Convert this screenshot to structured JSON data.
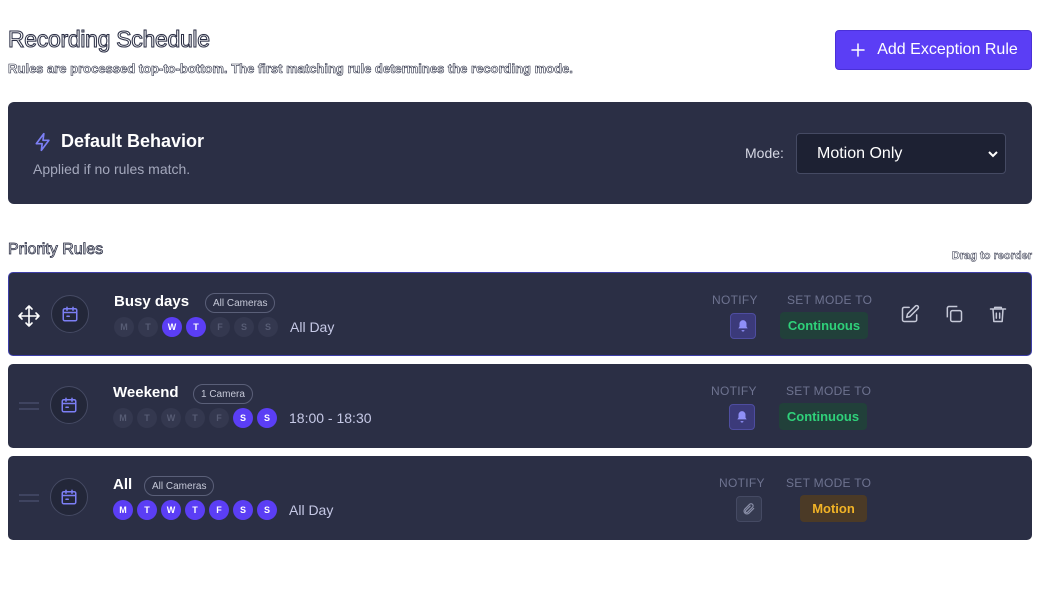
{
  "header": {
    "title": "Recording Schedule",
    "subtitle": "Rules are processed top-to-bottom. The first matching rule determines the recording mode.",
    "add_button_label": "Add Exception Rule"
  },
  "default_behavior": {
    "title": "Default Behavior",
    "subtitle": "Applied if no rules match.",
    "mode_label": "Mode:",
    "mode_value": "Motion Only"
  },
  "priority": {
    "title": "Priority Rules",
    "drag_hint": "Drag to reorder"
  },
  "labels": {
    "notify": "NOTIFY",
    "set_mode_to": "SET MODE TO"
  },
  "rules": [
    {
      "name": "Busy days",
      "scope": "All Cameras",
      "days": [
        {
          "letter": "M",
          "on": false
        },
        {
          "letter": "T",
          "on": false
        },
        {
          "letter": "W",
          "on": true
        },
        {
          "letter": "T",
          "on": true
        },
        {
          "letter": "F",
          "on": false
        },
        {
          "letter": "S",
          "on": false
        },
        {
          "letter": "S",
          "on": false
        }
      ],
      "time": "All Day",
      "notify": "bell-icon",
      "mode": "Continuous"
    },
    {
      "name": "Weekend",
      "scope": "1 Camera",
      "days": [
        {
          "letter": "M",
          "on": false
        },
        {
          "letter": "T",
          "on": false
        },
        {
          "letter": "W",
          "on": false
        },
        {
          "letter": "T",
          "on": false
        },
        {
          "letter": "F",
          "on": false
        },
        {
          "letter": "S",
          "on": true
        },
        {
          "letter": "S",
          "on": true
        }
      ],
      "time": "18:00 - 18:30",
      "notify": "bell-icon",
      "mode": "Continuous"
    },
    {
      "name": "All",
      "scope": "All Cameras",
      "days": [
        {
          "letter": "M",
          "on": true
        },
        {
          "letter": "T",
          "on": true
        },
        {
          "letter": "W",
          "on": true
        },
        {
          "letter": "T",
          "on": true
        },
        {
          "letter": "F",
          "on": true
        },
        {
          "letter": "S",
          "on": true
        },
        {
          "letter": "S",
          "on": true
        }
      ],
      "time": "All Day",
      "notify": "paperclip-icon",
      "mode": "Motion"
    }
  ],
  "colors": {
    "accent": "#5b3ef5",
    "card": "#2b2f45",
    "continuous": "#2fd17a",
    "motion": "#f1b326"
  }
}
